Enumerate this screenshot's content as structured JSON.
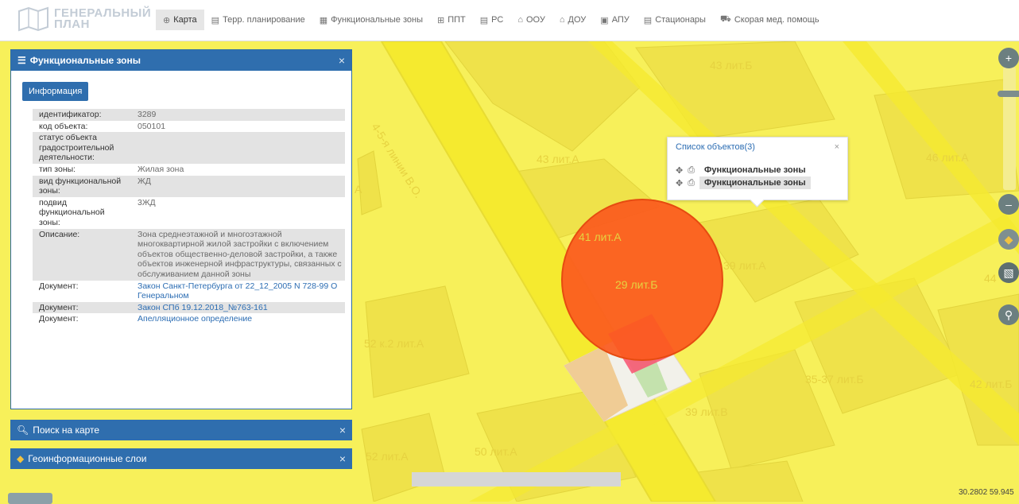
{
  "logo": {
    "line1": "ГЕНЕРАЛЬНЫЙ",
    "line2": "ПЛАН"
  },
  "nav": [
    {
      "icon": "⊕",
      "label": "Карта",
      "active": true
    },
    {
      "icon": "▤",
      "label": "Терр. планирование"
    },
    {
      "icon": "▦",
      "label": "Функциональные зоны"
    },
    {
      "icon": "⊞",
      "label": "ППТ"
    },
    {
      "icon": "▤",
      "label": "РС"
    },
    {
      "icon": "⌂",
      "label": "ООУ"
    },
    {
      "icon": "⌂",
      "label": "ДОУ"
    },
    {
      "icon": "▣",
      "label": "АПУ"
    },
    {
      "icon": "▤",
      "label": "Стационары"
    },
    {
      "icon": "⛟",
      "label": "Скорая мед. помощь"
    }
  ],
  "panel": {
    "title": "Функциональные зоны",
    "close": "×",
    "info_button": "Информация",
    "rows": [
      {
        "k": "идентификатор:",
        "v": "3289"
      },
      {
        "k": "код объекта:",
        "v": "050101"
      },
      {
        "k": "статус объекта градостроительной деятельности:",
        "v": ""
      },
      {
        "k": "тип зоны:",
        "v": "Жилая зона"
      },
      {
        "k": "вид функциональной зоны:",
        "v": "ЖД"
      },
      {
        "k": "подвид функциональной зоны:",
        "v": "3ЖД"
      },
      {
        "k": "Описание:",
        "v": "Зона среднеэтажной и многоэтажной многоквартирной жилой застройки с включением объектов общественно-деловой застройки, а также объектов инженерной инфраструктуры, связанных с обслуживанием данной зоны"
      },
      {
        "k": "Документ:",
        "v": "Закон Санкт-Петербурга от 22_12_2005 N 728-99 О Генеральном",
        "link": true
      },
      {
        "k": "Документ:",
        "v": "Закон СПб 19.12.2018_№763-161",
        "link": true
      },
      {
        "k": "Документ:",
        "v": "Апелляционное определение",
        "link": true
      }
    ]
  },
  "search_bar": {
    "title": "Поиск на карте",
    "close": "×"
  },
  "layers_bar": {
    "title": "Геоинформационные слои",
    "close": "×"
  },
  "popup": {
    "title": "Список объектов(3)",
    "close": "×",
    "items": [
      "Функциональные зоны",
      "Функциональные зоны"
    ]
  },
  "map_labels": [
    "43 лит.Б",
    "43 лит.А",
    "46 лит.А",
    "4-5-я линии В.О.",
    "41 лит.А",
    "39 лит.А",
    "29 лит.Б",
    "44",
    "52 к.2 лит.А",
    "35-37 лит.Б",
    "42 лит.Б",
    "39 лит.В",
    "50 лит.А",
    "52 лит.А",
    "А"
  ],
  "controls": {
    "zoom_in": "+",
    "zoom_out": "–",
    "search": "🔍"
  },
  "coords": "30.2802  59.945",
  "colors": {
    "zone": "#f7f05a",
    "road": "#f4ea3a",
    "building": "#f0e34a",
    "marker": "#fb5a1e",
    "accent": "#2f6eae"
  }
}
